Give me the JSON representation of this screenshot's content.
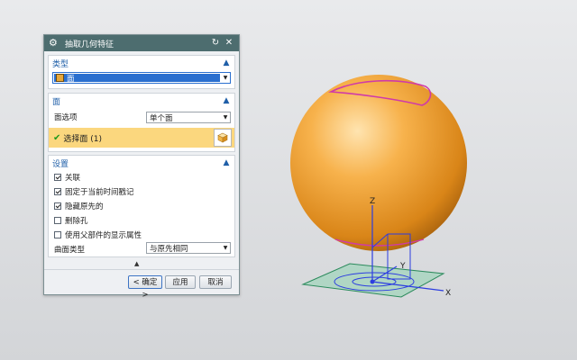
{
  "dialog": {
    "title": "抽取几何特征",
    "type_group": {
      "header": "类型",
      "selected": "面"
    },
    "face_group": {
      "header": "面",
      "option_label": "面选项",
      "option_value": "单个面",
      "selection_label": "选择面 (1)"
    },
    "settings_group": {
      "header": "设置",
      "checkboxes": [
        {
          "label": "关联",
          "checked": true
        },
        {
          "label": "固定于当前时间戳记",
          "checked": true
        },
        {
          "label": "隐藏原先的",
          "checked": true
        },
        {
          "label": "删除孔",
          "checked": false
        },
        {
          "label": "使用父部件的显示属性",
          "checked": false
        }
      ],
      "surface_type_label": "曲面类型",
      "surface_type_value": "与原先相同"
    },
    "buttons": {
      "ok": "< 确定 >",
      "apply": "应用",
      "cancel": "取消"
    }
  },
  "viewport": {
    "axis_x": "X",
    "axis_y": "Y",
    "axis_z": "Z",
    "colors": {
      "sphere": "#f2a335",
      "edge": "#d03aa8",
      "plane": "#6fbf9a",
      "axes": "#2c3de0"
    }
  }
}
